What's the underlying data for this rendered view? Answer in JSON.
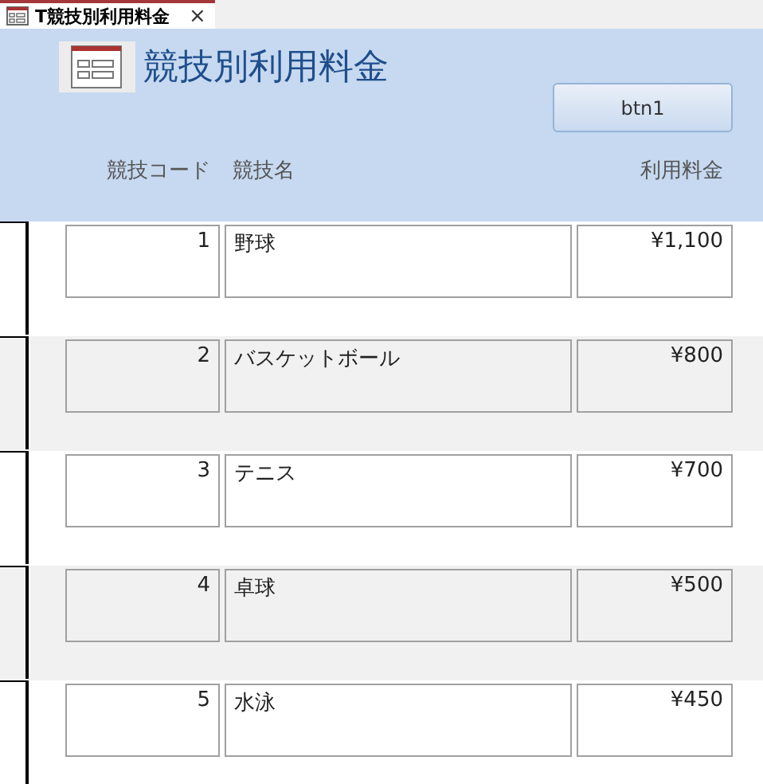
{
  "tab": {
    "title": "T競技別利用料金",
    "close": "×",
    "selected": true
  },
  "form": {
    "title": "競技別利用料金",
    "button": "btn1"
  },
  "columns": [
    "競技コード",
    "競技名",
    "利用料金"
  ],
  "rows": [
    {
      "code": "1",
      "name": "野球",
      "fee": "¥1,100"
    },
    {
      "code": "2",
      "name": "バスケットボール",
      "fee": "¥800"
    },
    {
      "code": "3",
      "name": "テニス",
      "fee": "¥700"
    },
    {
      "code": "4",
      "name": "卓球",
      "fee": "¥500"
    },
    {
      "code": "5",
      "name": "水泳",
      "fee": "¥450"
    }
  ]
}
